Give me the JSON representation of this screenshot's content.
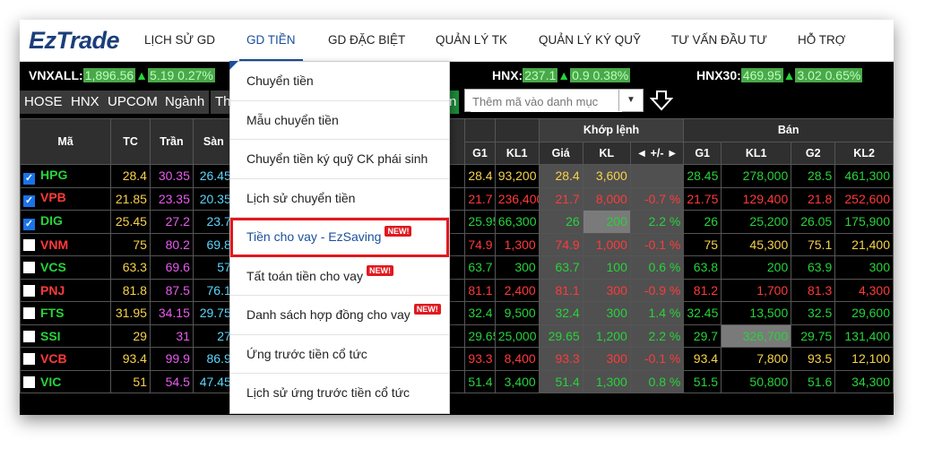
{
  "app": {
    "logo": "EzTrade"
  },
  "nav": [
    {
      "label": "LỊCH SỬ GD"
    },
    {
      "label": "GD TIỀN"
    },
    {
      "label": "GD ĐẶC BIỆT"
    },
    {
      "label": "QUẢN LÝ TK"
    },
    {
      "label": "QUẢN LÝ KÝ QUỸ"
    },
    {
      "label": "TƯ VẤN ĐẦU TƯ"
    },
    {
      "label": "HỖ TRỢ"
    }
  ],
  "indices": {
    "vnxall": {
      "label": "VNXALL:",
      "value": "1,896.56",
      "change": "5.19 0.27%"
    },
    "hnx": {
      "label": "HNX:",
      "value": "237.1",
      "change": "0.9 0.38%"
    },
    "hnx30": {
      "label": "HNX30:",
      "value": "469.95",
      "change": "3.02 0.65%"
    }
  },
  "tabs": [
    "HOSE",
    "HNX",
    "UPCOM",
    "Ngành",
    "Th"
  ],
  "tab_partial": "n",
  "watchlist_search": {
    "placeholder": "Thêm mã vào danh mục"
  },
  "table": {
    "group_headers": {
      "match": "Khớp lệnh",
      "sell": "Bán"
    },
    "headers": {
      "symbol": "Mã",
      "ref": "TC",
      "ceil": "Trần",
      "floor": "Sàn",
      "bid_g1": "G1",
      "bid_kl1": "KL1",
      "price": "Giá",
      "vol": "KL",
      "chg": "◄ +/- ►",
      "ask_g1": "G1",
      "ask_kl1": "KL1",
      "ask_g2": "G2",
      "ask_kl2": "KL2"
    },
    "rows": [
      {
        "sym": "HPG",
        "checked": true,
        "tc": "28.4",
        "tran": "30.35",
        "san": "26.45",
        "bg1": "28.4",
        "bkl1": "93,200",
        "gia": "28.4",
        "kl": "3,600",
        "chg": "",
        "ag1": "28.45",
        "akl1": "278,000",
        "ag2": "28.5",
        "akl2": "461,300"
      },
      {
        "sym": "VPB",
        "checked": true,
        "tc": "21.85",
        "tran": "23.35",
        "san": "20.35",
        "bg1": "21.7",
        "bkl1": "236,400",
        "gia": "21.7",
        "kl": "8,000",
        "chg": "-0.7 %",
        "ag1": "21.75",
        "akl1": "129,400",
        "ag2": "21.8",
        "akl2": "252,600"
      },
      {
        "sym": "DIG",
        "checked": true,
        "tc": "25.45",
        "tran": "27.2",
        "san": "23.7",
        "bg1": "25.95",
        "bkl1": "66,300",
        "gia": "26",
        "kl": "200",
        "chg": "2.2 %",
        "ag1": "26",
        "akl1": "25,200",
        "ag2": "26.05",
        "akl2": "175,900"
      },
      {
        "sym": "VNM",
        "checked": false,
        "tc": "75",
        "tran": "80.2",
        "san": "69.8",
        "bg1": "74.9",
        "bkl1": "1,300",
        "gia": "74.9",
        "kl": "1,000",
        "chg": "-0.1 %",
        "ag1": "75",
        "akl1": "45,300",
        "ag2": "75.1",
        "akl2": "21,400"
      },
      {
        "sym": "VCS",
        "checked": false,
        "tc": "63.3",
        "tran": "69.6",
        "san": "57",
        "bg1": "63.7",
        "bkl1": "300",
        "gia": "63.7",
        "kl": "100",
        "chg": "0.6 %",
        "ag1": "63.8",
        "akl1": "200",
        "ag2": "63.9",
        "akl2": "300"
      },
      {
        "sym": "PNJ",
        "checked": false,
        "tc": "81.8",
        "tran": "87.5",
        "san": "76.1",
        "bg1": "81.1",
        "bkl1": "2,400",
        "gia": "81.1",
        "kl": "300",
        "chg": "-0.9 %",
        "ag1": "81.2",
        "akl1": "1,700",
        "ag2": "81.3",
        "akl2": "4,300"
      },
      {
        "sym": "FTS",
        "checked": false,
        "tc": "31.95",
        "tran": "34.15",
        "san": "29.75",
        "bg1": "32.4",
        "bkl1": "9,500",
        "gia": "32.4",
        "kl": "300",
        "chg": "1.4 %",
        "ag1": "32.45",
        "akl1": "13,500",
        "ag2": "32.5",
        "akl2": "29,600"
      },
      {
        "sym": "SSI",
        "checked": false,
        "tc": "29",
        "tran": "31",
        "san": "27",
        "bg1": "29.65",
        "bkl1": "25,000",
        "gia": "29.65",
        "kl": "1,200",
        "chg": "2.2 %",
        "ag1": "29.7",
        "akl1": "326,700",
        "ag2": "29.75",
        "akl2": "131,400"
      },
      {
        "sym": "VCB",
        "checked": false,
        "tc": "93.4",
        "tran": "99.9",
        "san": "86.9",
        "bg1": "93.3",
        "bkl1": "8,400",
        "gia": "93.3",
        "kl": "300",
        "chg": "-0.1 %",
        "ag1": "93.4",
        "akl1": "7,800",
        "ag2": "93.5",
        "akl2": "12,100"
      },
      {
        "sym": "VIC",
        "checked": false,
        "tc": "51",
        "tran": "54.5",
        "san": "47.45",
        "bg1": "51.4",
        "bkl1": "3,400",
        "gia": "51.4",
        "kl": "1,300",
        "chg": "0.8 %",
        "ag1": "51.5",
        "akl1": "50,800",
        "ag2": "51.6",
        "akl2": "34,300"
      }
    ]
  },
  "dropdown": {
    "items": [
      {
        "label": "Chuyển tiền",
        "new": false
      },
      {
        "label": "Mẫu chuyển tiền",
        "new": false
      },
      {
        "label": "Chuyển tiền ký quỹ CK phái sinh",
        "new": false
      },
      {
        "label": "Lịch sử chuyển tiền",
        "new": false
      },
      {
        "label": "Tiền cho vay - EzSaving",
        "new": true
      },
      {
        "label": "Tất toán tiền cho vay",
        "new": true
      },
      {
        "label": "Danh sách hợp đồng cho vay",
        "new": true
      },
      {
        "label": "Ứng trước tiền cổ tức",
        "new": false
      },
      {
        "label": "Lịch sử ứng trước tiền cổ tức",
        "new": false
      }
    ],
    "new_badge": "NEW!"
  },
  "colors": {
    "up": "#27d33a",
    "down": "#ff3a3a",
    "ref": "#f7d24a",
    "ceil": "#e85cf0",
    "floor": "#5bd7ff",
    "highlight_border": "#e0191f",
    "brand": "#1a3e7a"
  }
}
